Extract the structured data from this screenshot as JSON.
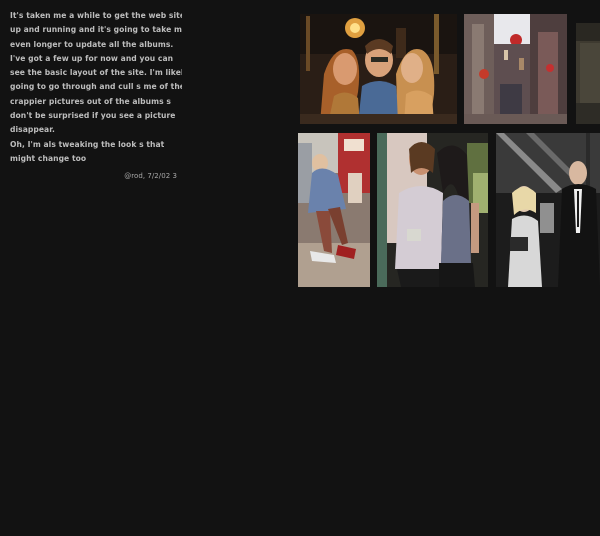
{
  "blog": {
    "lines": [
      "It's taken me a while to get the web site",
      "up and running and it's going to take me",
      "even longer to update all the albums.",
      "I've got a few up for now and you can",
      "see the basic layout of the site. I'm likely",
      "going to go through and cull s  me of the",
      "crappier pictures out of the albums s",
      "don't be surprised if you see a picture",
      "disappear.",
      "Oh, I'm als   tweaking the look s   that",
      "might change too"
    ],
    "signature": "@rod, 7/2/02  3"
  },
  "gallery": {
    "photos": [
      {
        "name": "photo-group-kiss",
        "icon": "photo-icon"
      },
      {
        "name": "photo-street-lanterns",
        "icon": "photo-icon"
      },
      {
        "name": "photo-edge-crop",
        "icon": "photo-icon"
      },
      {
        "name": "photo-street-walker",
        "icon": "photo-icon"
      },
      {
        "name": "photo-two-women",
        "icon": "photo-icon"
      },
      {
        "name": "photo-party-couple",
        "icon": "photo-icon"
      }
    ]
  }
}
